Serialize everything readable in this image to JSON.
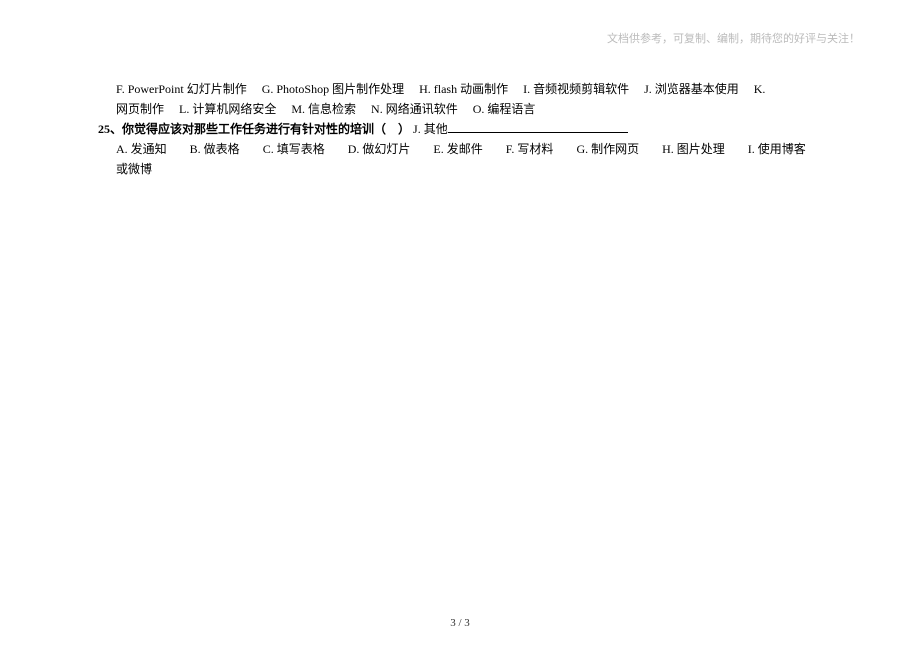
{
  "header": {
    "note": "文档供参考，可复制、编制，期待您的好评与关注！"
  },
  "q24_continued": {
    "options_line1": [
      "F. PowerPoint 幻灯片制作",
      "G. PhotoShop 图片制作处理",
      "H. flash 动画制作",
      "I. 音频视频剪辑软件",
      "J. 浏览器基本使用",
      "K."
    ],
    "options_line2_prefix": "网页制作",
    "options_line2_rest": [
      "L. 计算机网络安全",
      "M. 信息检索",
      "N. 网络通讯软件",
      "O. 编程语言"
    ]
  },
  "q25": {
    "number": "25、",
    "stem": "你觉得应该对那些工作任务进行有针对性的培训（",
    "paren_close": "）",
    "j_other": "J. 其他",
    "options_line": [
      "A. 发通知",
      "B. 做表格",
      "C. 填写表格",
      "D. 做幻灯片",
      "E. 发邮件",
      "F. 写材料",
      "G. 制作网页",
      "H. 图片处理",
      "I. 使用博客"
    ],
    "options_line2": "或微博"
  },
  "footer": {
    "page": "3 / 3"
  }
}
